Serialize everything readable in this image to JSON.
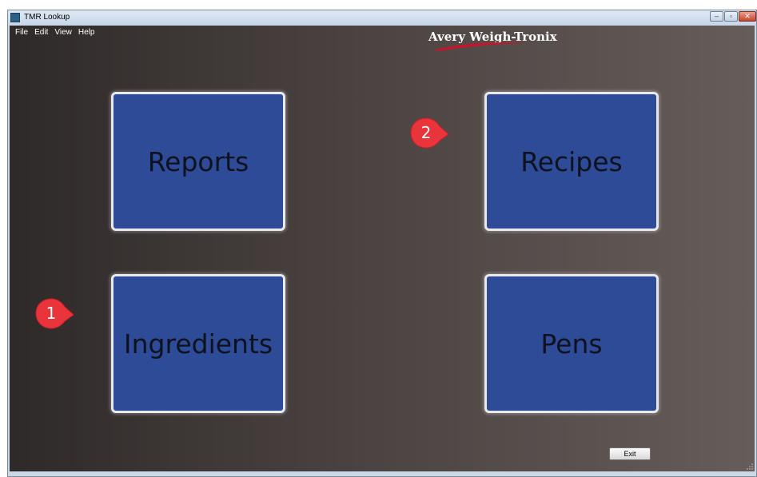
{
  "window": {
    "title": "TMR Lookup",
    "controls": {
      "minimize": "–",
      "maximize": "▫",
      "close": "✕"
    }
  },
  "menu": [
    "File",
    "Edit",
    "View",
    "Help"
  ],
  "logo": {
    "text": "Avery Weigh-Tronix"
  },
  "tiles": {
    "reports": "Reports",
    "recipes": "Recipes",
    "ingredients": "Ingredients",
    "pens": "Pens"
  },
  "callouts": {
    "first": "1",
    "second": "2"
  },
  "exit_label": "Exit",
  "colors": {
    "tile_fill": "#2d4b96",
    "tile_border": "#e8e8ee",
    "callout": "#e8343a",
    "logo_swoosh": "#c6162b"
  }
}
